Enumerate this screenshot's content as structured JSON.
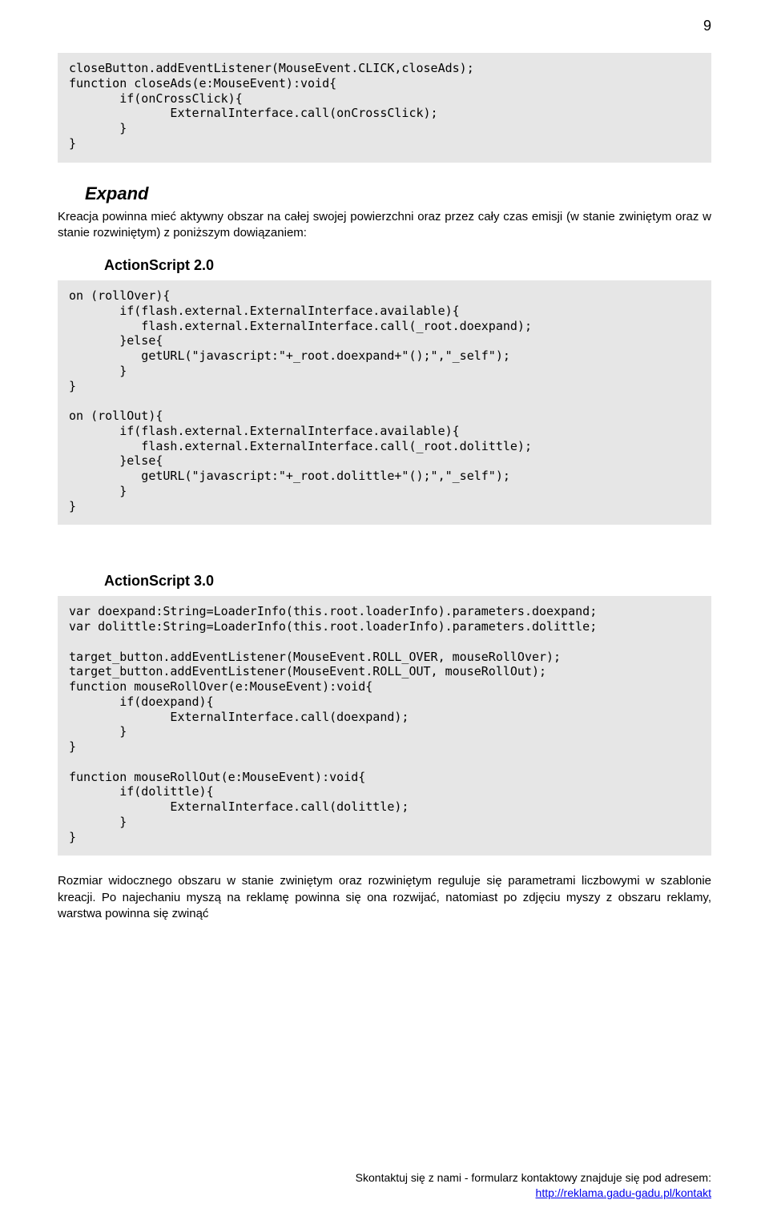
{
  "page_number": "9",
  "codeblock1": "closeButton.addEventListener(MouseEvent.CLICK,closeAds);\nfunction closeAds(e:MouseEvent):void{\n       if(onCrossClick){\n              ExternalInterface.call(onCrossClick);\n       }\n}",
  "section": {
    "heading": "Expand",
    "paragraph": "Kreacja powinna mieć aktywny obszar na całej swojej powierzchni oraz przez cały czas emisji (w stanie zwiniętym oraz w stanie rozwiniętym) z poniższym dowiązaniem:"
  },
  "as2": {
    "heading": "ActionScript 2.0",
    "code": "on (rollOver){\n       if(flash.external.ExternalInterface.available){\n          flash.external.ExternalInterface.call(_root.doexpand);\n       }else{\n          getURL(\"javascript:\"+_root.doexpand+\"();\",\"_self\");\n       }\n}\n\non (rollOut){\n       if(flash.external.ExternalInterface.available){\n          flash.external.ExternalInterface.call(_root.dolittle);\n       }else{\n          getURL(\"javascript:\"+_root.dolittle+\"();\",\"_self\");\n       }\n}"
  },
  "as3": {
    "heading": "ActionScript 3.0",
    "code": "var doexpand:String=LoaderInfo(this.root.loaderInfo).parameters.doexpand;\nvar dolittle:String=LoaderInfo(this.root.loaderInfo).parameters.dolittle;\n\ntarget_button.addEventListener(MouseEvent.ROLL_OVER, mouseRollOver);\ntarget_button.addEventListener(MouseEvent.ROLL_OUT, mouseRollOut);\nfunction mouseRollOver(e:MouseEvent):void{\n       if(doexpand){\n              ExternalInterface.call(doexpand);\n       }\n}\n\nfunction mouseRollOut(e:MouseEvent):void{\n       if(dolittle){\n              ExternalInterface.call(dolittle);\n       }\n}"
  },
  "closing_paragraph": "Rozmiar widocznego obszaru w stanie zwiniętym oraz rozwiniętym reguluje się parametrami liczbowymi w szablonie kreacji. Po najechaniu myszą na reklamę powinna się ona rozwijać, natomiast po zdjęciu myszy z obszaru reklamy, warstwa powinna się zwinąć",
  "footer": {
    "line1": "Skontaktuj się z nami - formularz kontaktowy znajduje się pod adresem:",
    "link_text": "http://reklama.gadu-gadu.pl/kontakt"
  }
}
